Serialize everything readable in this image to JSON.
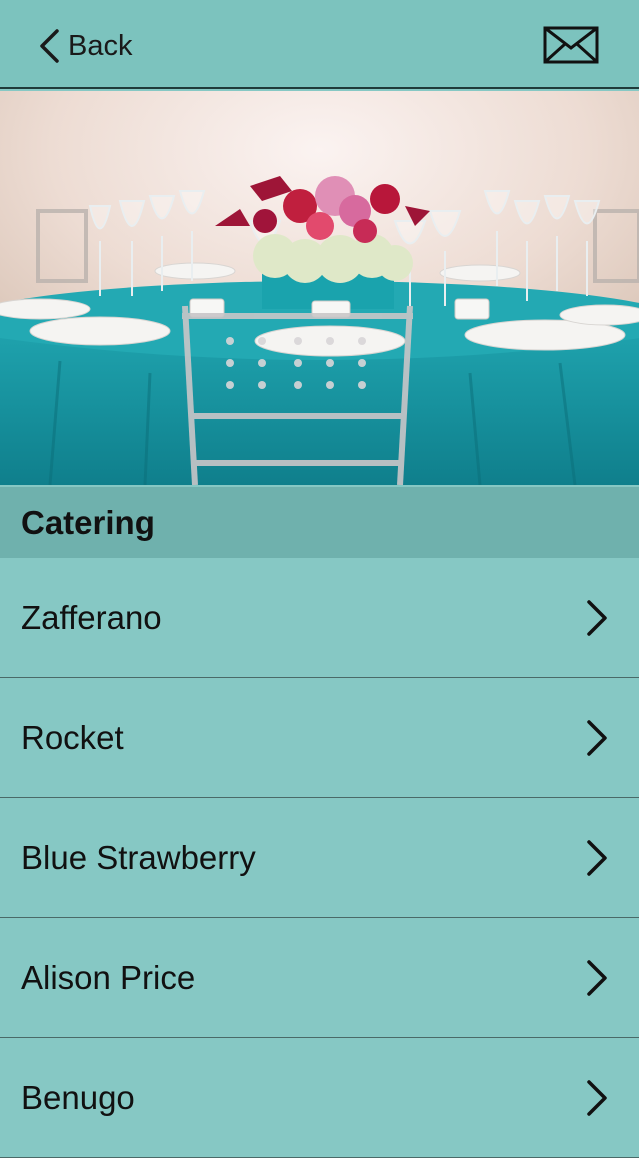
{
  "navbar": {
    "back_label": "Back",
    "back_icon": "chevron-left-icon",
    "mail_icon": "mail-envelope-icon",
    "background": "#7cc3be"
  },
  "hero": {
    "image": "banquet-table-photo",
    "tablecloth_color": "#1a9aa6"
  },
  "section": {
    "title": "Catering"
  },
  "list": {
    "items": [
      {
        "label": "Zafferano"
      },
      {
        "label": "Rocket"
      },
      {
        "label": "Blue Strawberry"
      },
      {
        "label": "Alison Price"
      },
      {
        "label": "Benugo"
      }
    ],
    "chevron_icon": "chevron-right-icon"
  },
  "colors": {
    "list_background": "#86c8c4",
    "section_background": "#6fb1ad"
  }
}
